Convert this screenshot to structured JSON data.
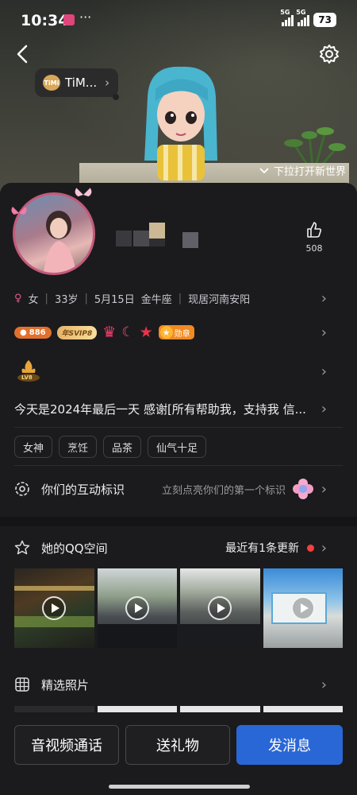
{
  "status_bar": {
    "time": "10:34",
    "dots": "···",
    "net1": "5G",
    "net2": "5G",
    "battery": "73"
  },
  "header": {
    "tim_label": "TiM...",
    "tim_logo": "TiMi",
    "pulldown_text": "下拉打开新世界"
  },
  "profile": {
    "likes": "508",
    "gender": "女",
    "age": "33岁",
    "birthday": "5月15日",
    "zodiac": "金牛座",
    "location": "现居河南安阳",
    "badges": {
      "coin_value": "886",
      "svip": "年SVIP8",
      "medal": "勋章"
    },
    "level": "LV8",
    "signature": "今天是2024年最后一天 感谢[所有帮助我，支持我 信...",
    "tags": [
      "女神",
      "烹饪",
      "品茶",
      "仙气十足"
    ],
    "interaction_label": "你们的互动标识",
    "interaction_hint": "立刻点亮你们的第一个标识"
  },
  "qzone": {
    "label": "她的QQ空间",
    "update_text": "最近有1条更新"
  },
  "photos": {
    "label": "精选照片"
  },
  "actions": {
    "call": "音视频通话",
    "gift": "送礼物",
    "message": "发消息"
  },
  "colors": {
    "accent_blue": "#2a67d6",
    "female_pink": "#e35a86",
    "update_dot": "#f5413e"
  }
}
